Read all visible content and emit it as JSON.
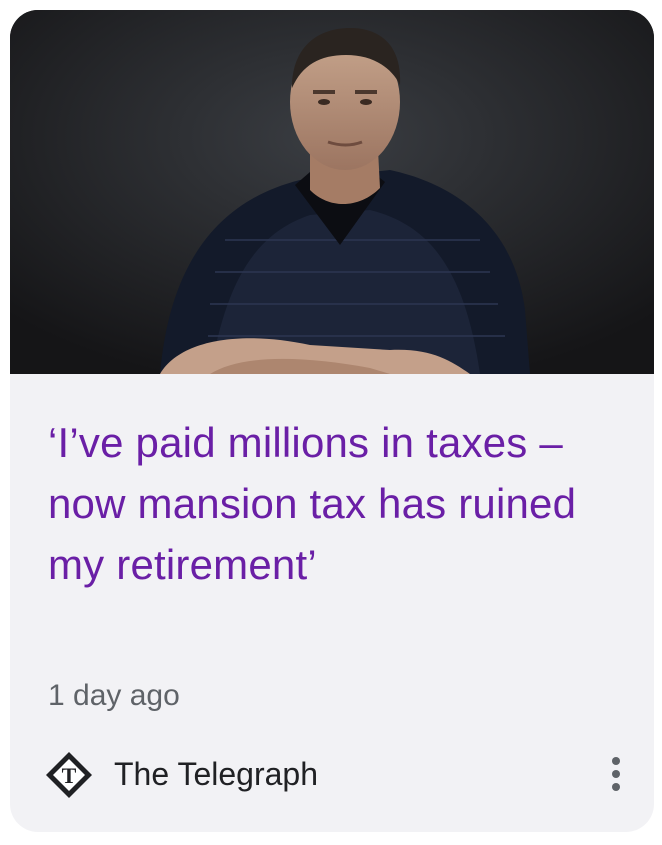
{
  "article": {
    "headline": "‘I’ve paid millions in taxes – now mansion tax has ruined my retirement’",
    "time_ago": "1 day ago",
    "source": "The Telegraph",
    "source_logo_letter": "T",
    "image_icon": "portrait-photo",
    "more_icon": "more-vert-icon"
  },
  "colors": {
    "headline": "#6a1fa6",
    "card_background": "#f2f2f5",
    "meta_text": "#5f6368"
  }
}
